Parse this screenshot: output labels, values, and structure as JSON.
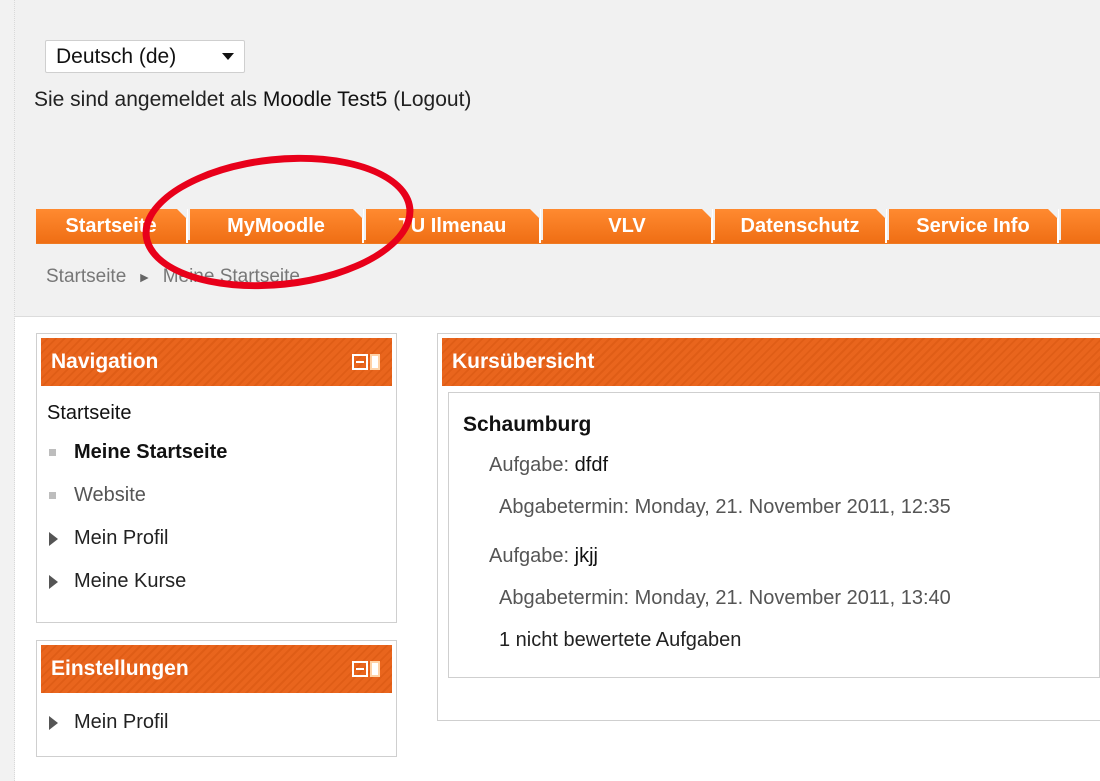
{
  "header": {
    "language": "Deutsch (de)",
    "login_prefix": "Sie sind angemeldet als",
    "user_name": "Moodle Test5",
    "logout_label": "(Logout)"
  },
  "tabs": [
    {
      "label": "Startseite"
    },
    {
      "label": "MyMoodle"
    },
    {
      "label": "TU Ilmenau"
    },
    {
      "label": "VLV"
    },
    {
      "label": "Datenschutz"
    },
    {
      "label": "Service Info"
    }
  ],
  "breadcrumb": {
    "home": "Startseite",
    "separator": "►",
    "current": "Meine Startseite"
  },
  "navigation": {
    "title": "Navigation",
    "root": "Startseite",
    "items": [
      {
        "label": "Meine Startseite"
      },
      {
        "label": "Website"
      },
      {
        "label": "Mein Profil"
      },
      {
        "label": "Meine Kurse"
      }
    ]
  },
  "settings": {
    "title": "Einstellungen",
    "items": [
      {
        "label": "Mein Profil"
      }
    ]
  },
  "course_overview": {
    "title": "Kursübersicht",
    "course_name": "Schaumburg",
    "assignments": [
      {
        "type_label": "Aufgabe:",
        "name": "dfdf",
        "due_label": "Abgabetermin:",
        "due": "Monday, 21. November 2011, 12:35"
      },
      {
        "type_label": "Aufgabe:",
        "name": "jkjj",
        "due_label": "Abgabetermin:",
        "due": "Monday, 21. November 2011, 13:40"
      }
    ],
    "ungraded_note": "1 nicht bewertete Aufgaben"
  },
  "colors": {
    "accent": "#ef6e14",
    "annotation": "#e8001a"
  }
}
